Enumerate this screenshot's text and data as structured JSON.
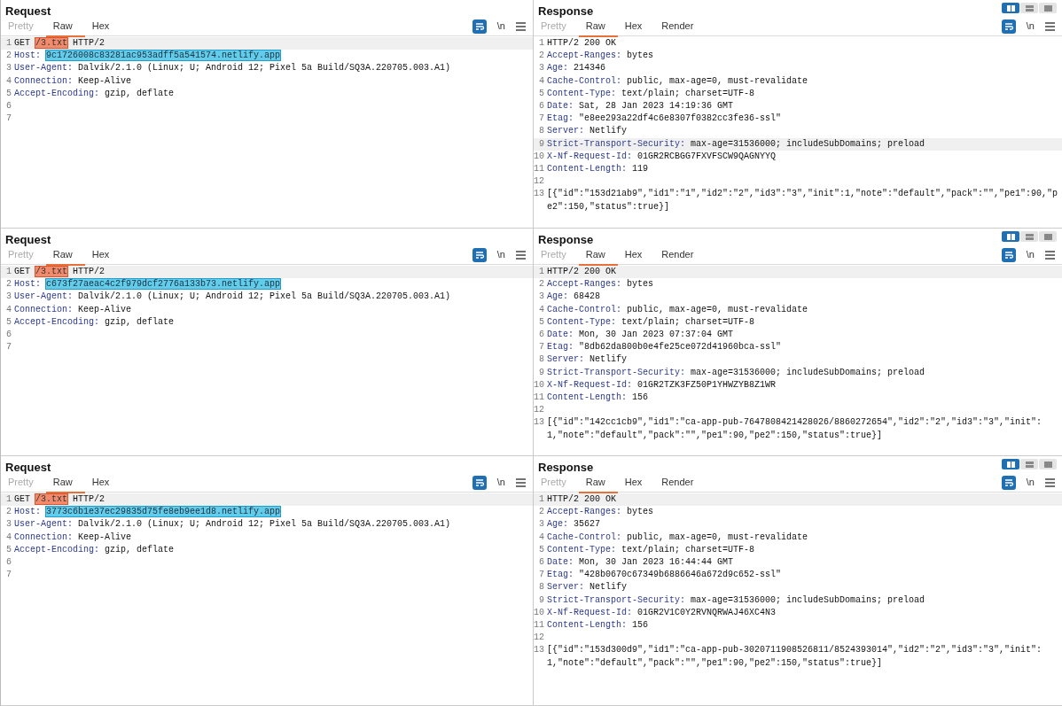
{
  "rows": [
    {
      "request": {
        "title": "Request",
        "tabs": [
          {
            "label": "Pretty",
            "selected": false,
            "disabled": true
          },
          {
            "label": "Raw",
            "selected": true,
            "disabled": false
          },
          {
            "label": "Hex",
            "selected": false,
            "disabled": false
          }
        ],
        "wrap_on": true,
        "newline_label": "\\n",
        "lines": [
          {
            "number": "1",
            "highlighted": true,
            "segments": [
              {
                "text": "GET ",
                "kind": "text"
              },
              {
                "text": "/3.txt",
                "kind": "path"
              },
              {
                "text": " HTTP/2",
                "kind": "text"
              }
            ]
          },
          {
            "number": "2",
            "highlighted": false,
            "segments": [
              {
                "text": "Host: ",
                "kind": "key"
              },
              {
                "text": "9c1726008c83281ac953adff5a541574.netlify.app",
                "kind": "host"
              }
            ]
          },
          {
            "number": "3",
            "highlighted": false,
            "segments": [
              {
                "text": "User-Agent:",
                "kind": "key"
              },
              {
                "text": " Dalvik/2.1.0 (Linux; U; Android 12; Pixel 5a Build/SQ3A.220705.003.A1)",
                "kind": "text"
              }
            ]
          },
          {
            "number": "4",
            "highlighted": false,
            "segments": [
              {
                "text": "Connection:",
                "kind": "key"
              },
              {
                "text": " Keep-Alive",
                "kind": "text"
              }
            ]
          },
          {
            "number": "5",
            "highlighted": false,
            "segments": [
              {
                "text": "Accept-Encoding:",
                "kind": "key"
              },
              {
                "text": " gzip, deflate",
                "kind": "text"
              }
            ]
          },
          {
            "number": "6",
            "highlighted": false
          },
          {
            "number": "7",
            "highlighted": false
          }
        ]
      },
      "response": {
        "title": "Response",
        "view_modes": [
          {
            "selected": true
          },
          {
            "selected": false
          },
          {
            "selected": false
          }
        ],
        "tabs": [
          {
            "label": "Pretty",
            "selected": false,
            "disabled": true
          },
          {
            "label": "Raw",
            "selected": true,
            "disabled": false
          },
          {
            "label": "Hex",
            "selected": false,
            "disabled": false
          },
          {
            "label": "Render",
            "selected": false,
            "disabled": false
          }
        ],
        "wrap_on": true,
        "newline_label": "\\n",
        "lines": [
          {
            "number": "1",
            "highlighted": false,
            "segments": [
              {
                "text": "HTTP/2 200 OK",
                "kind": "text"
              }
            ]
          },
          {
            "number": "2",
            "highlighted": false,
            "segments": [
              {
                "text": "Accept-Ranges:",
                "kind": "key"
              },
              {
                "text": " bytes",
                "kind": "text"
              }
            ]
          },
          {
            "number": "3",
            "highlighted": false,
            "segments": [
              {
                "text": "Age:",
                "kind": "key"
              },
              {
                "text": " 214346",
                "kind": "text"
              }
            ]
          },
          {
            "number": "4",
            "highlighted": false,
            "segments": [
              {
                "text": "Cache-Control:",
                "kind": "key"
              },
              {
                "text": " public, max-age=0, must-revalidate",
                "kind": "text"
              }
            ]
          },
          {
            "number": "5",
            "highlighted": false,
            "segments": [
              {
                "text": "Content-Type:",
                "kind": "key"
              },
              {
                "text": " text/plain; charset=UTF-8",
                "kind": "text"
              }
            ]
          },
          {
            "number": "6",
            "highlighted": false,
            "segments": [
              {
                "text": "Date:",
                "kind": "key"
              },
              {
                "text": " Sat, 28 Jan 2023 14:19:36 GMT",
                "kind": "text"
              }
            ]
          },
          {
            "number": "7",
            "highlighted": false,
            "segments": [
              {
                "text": "Etag:",
                "kind": "key"
              },
              {
                "text": " \"e8ee293a22df4c6e8307f0382cc3fe36-ssl\"",
                "kind": "text"
              }
            ]
          },
          {
            "number": "8",
            "highlighted": false,
            "segments": [
              {
                "text": "Server:",
                "kind": "key"
              },
              {
                "text": " Netlify",
                "kind": "text"
              }
            ]
          },
          {
            "number": "9",
            "highlighted": true,
            "segments": [
              {
                "text": "Strict-Transport-Security:",
                "kind": "key"
              },
              {
                "text": " max-age=31536000; includeSubDomains; preload",
                "kind": "text"
              }
            ]
          },
          {
            "number": "10",
            "highlighted": false,
            "segments": [
              {
                "text": "X-Nf-Request-Id:",
                "kind": "key"
              },
              {
                "text": " 01GR2RCBGG7FXVFSCW9QAGNYYQ",
                "kind": "text"
              }
            ]
          },
          {
            "number": "11",
            "highlighted": false,
            "segments": [
              {
                "text": "Content-Length:",
                "kind": "key"
              },
              {
                "text": " 119",
                "kind": "text"
              }
            ]
          },
          {
            "number": "12",
            "highlighted": false
          },
          {
            "number": "13",
            "highlighted": false,
            "segments": [
              {
                "text": "[{\"id\":\"153d21ab9\",\"id1\":\"1\",\"id2\":\"2\",\"id3\":\"3\",\"init\":1,\"note\":\"default\",\"pack\":\"\",\"pe1\":90,\"pe2\":150,\"status\":true}]",
                "kind": "text"
              }
            ]
          }
        ]
      }
    },
    {
      "request": {
        "title": "Request",
        "tabs": [
          {
            "label": "Pretty",
            "selected": false,
            "disabled": true
          },
          {
            "label": "Raw",
            "selected": true,
            "disabled": false
          },
          {
            "label": "Hex",
            "selected": false,
            "disabled": false
          }
        ],
        "wrap_on": true,
        "newline_label": "\\n",
        "lines": [
          {
            "number": "1",
            "highlighted": true,
            "segments": [
              {
                "text": "GET ",
                "kind": "text"
              },
              {
                "text": "/3.txt",
                "kind": "path"
              },
              {
                "text": " HTTP/2",
                "kind": "text"
              }
            ]
          },
          {
            "number": "2",
            "highlighted": false,
            "segments": [
              {
                "text": "Host: ",
                "kind": "key"
              },
              {
                "text": "c673f27aeac4c2f979dcf2776a133b73.netlify.app",
                "kind": "host"
              }
            ]
          },
          {
            "number": "3",
            "highlighted": false,
            "segments": [
              {
                "text": "User-Agent:",
                "kind": "key"
              },
              {
                "text": " Dalvik/2.1.0 (Linux; U; Android 12; Pixel 5a Build/SQ3A.220705.003.A1)",
                "kind": "text"
              }
            ]
          },
          {
            "number": "4",
            "highlighted": false,
            "segments": [
              {
                "text": "Connection:",
                "kind": "key"
              },
              {
                "text": " Keep-Alive",
                "kind": "text"
              }
            ]
          },
          {
            "number": "5",
            "highlighted": false,
            "segments": [
              {
                "text": "Accept-Encoding:",
                "kind": "key"
              },
              {
                "text": " gzip, deflate",
                "kind": "text"
              }
            ]
          },
          {
            "number": "6",
            "highlighted": false
          },
          {
            "number": "7",
            "highlighted": false
          }
        ]
      },
      "response": {
        "title": "Response",
        "view_modes": [
          {
            "selected": true
          },
          {
            "selected": false
          },
          {
            "selected": false
          }
        ],
        "tabs": [
          {
            "label": "Pretty",
            "selected": false,
            "disabled": true
          },
          {
            "label": "Raw",
            "selected": true,
            "disabled": false
          },
          {
            "label": "Hex",
            "selected": false,
            "disabled": false
          },
          {
            "label": "Render",
            "selected": false,
            "disabled": false
          }
        ],
        "wrap_on": true,
        "newline_label": "\\n",
        "lines": [
          {
            "number": "1",
            "highlighted": true,
            "segments": [
              {
                "text": "HTTP/2 200 OK",
                "kind": "text"
              }
            ]
          },
          {
            "number": "2",
            "highlighted": false,
            "segments": [
              {
                "text": "Accept-Ranges:",
                "kind": "key"
              },
              {
                "text": " bytes",
                "kind": "text"
              }
            ]
          },
          {
            "number": "3",
            "highlighted": false,
            "segments": [
              {
                "text": "Age:",
                "kind": "key"
              },
              {
                "text": " 68428",
                "kind": "text"
              }
            ]
          },
          {
            "number": "4",
            "highlighted": false,
            "segments": [
              {
                "text": "Cache-Control:",
                "kind": "key"
              },
              {
                "text": " public, max-age=0, must-revalidate",
                "kind": "text"
              }
            ]
          },
          {
            "number": "5",
            "highlighted": false,
            "segments": [
              {
                "text": "Content-Type:",
                "kind": "key"
              },
              {
                "text": " text/plain; charset=UTF-8",
                "kind": "text"
              }
            ]
          },
          {
            "number": "6",
            "highlighted": false,
            "segments": [
              {
                "text": "Date:",
                "kind": "key"
              },
              {
                "text": " Mon, 30 Jan 2023 07:37:04 GMT",
                "kind": "text"
              }
            ]
          },
          {
            "number": "7",
            "highlighted": false,
            "segments": [
              {
                "text": "Etag:",
                "kind": "key"
              },
              {
                "text": " \"8db62da800b0e4fe25ce072d41960bca-ssl\"",
                "kind": "text"
              }
            ]
          },
          {
            "number": "8",
            "highlighted": false,
            "segments": [
              {
                "text": "Server:",
                "kind": "key"
              },
              {
                "text": " Netlify",
                "kind": "text"
              }
            ]
          },
          {
            "number": "9",
            "highlighted": false,
            "segments": [
              {
                "text": "Strict-Transport-Security:",
                "kind": "key"
              },
              {
                "text": " max-age=31536000; includeSubDomains; preload",
                "kind": "text"
              }
            ]
          },
          {
            "number": "10",
            "highlighted": false,
            "segments": [
              {
                "text": "X-Nf-Request-Id:",
                "kind": "key"
              },
              {
                "text": " 01GR2TZK3FZ50P1YHWZYB8Z1WR",
                "kind": "text"
              }
            ]
          },
          {
            "number": "11",
            "highlighted": false,
            "segments": [
              {
                "text": "Content-Length:",
                "kind": "key"
              },
              {
                "text": " 156",
                "kind": "text"
              }
            ]
          },
          {
            "number": "12",
            "highlighted": false
          },
          {
            "number": "13",
            "highlighted": false,
            "segments": [
              {
                "text": "[{\"id\":\"142cc1cb9\",\"id1\":\"ca-app-pub-7647808421428026/8860272654\",\"id2\":\"2\",\"id3\":\"3\",\"init\":1,\"note\":\"default\",\"pack\":\"\",\"pe1\":90,\"pe2\":150,\"status\":true}]",
                "kind": "text"
              }
            ]
          }
        ]
      }
    },
    {
      "request": {
        "title": "Request",
        "tabs": [
          {
            "label": "Pretty",
            "selected": false,
            "disabled": true
          },
          {
            "label": "Raw",
            "selected": true,
            "disabled": false
          },
          {
            "label": "Hex",
            "selected": false,
            "disabled": false
          }
        ],
        "wrap_on": true,
        "newline_label": "\\n",
        "lines": [
          {
            "number": "1",
            "highlighted": true,
            "segments": [
              {
                "text": "GET ",
                "kind": "text"
              },
              {
                "text": "/3.txt",
                "kind": "path"
              },
              {
                "text": " HTTP/2",
                "kind": "text"
              }
            ]
          },
          {
            "number": "2",
            "highlighted": false,
            "segments": [
              {
                "text": "Host: ",
                "kind": "key"
              },
              {
                "text": "3773c6b1e37ec29835d75fe8eb9ee1d8.netlify.app",
                "kind": "host"
              }
            ]
          },
          {
            "number": "3",
            "highlighted": false,
            "segments": [
              {
                "text": "User-Agent:",
                "kind": "key"
              },
              {
                "text": " Dalvik/2.1.0 (Linux; U; Android 12; Pixel 5a Build/SQ3A.220705.003.A1)",
                "kind": "text"
              }
            ]
          },
          {
            "number": "4",
            "highlighted": false,
            "segments": [
              {
                "text": "Connection:",
                "kind": "key"
              },
              {
                "text": " Keep-Alive",
                "kind": "text"
              }
            ]
          },
          {
            "number": "5",
            "highlighted": false,
            "segments": [
              {
                "text": "Accept-Encoding:",
                "kind": "key"
              },
              {
                "text": " gzip, deflate",
                "kind": "text"
              }
            ]
          },
          {
            "number": "6",
            "highlighted": false
          },
          {
            "number": "7",
            "highlighted": false
          }
        ]
      },
      "response": {
        "title": "Response",
        "view_modes": [
          {
            "selected": true
          },
          {
            "selected": false
          },
          {
            "selected": false
          }
        ],
        "tabs": [
          {
            "label": "Pretty",
            "selected": false,
            "disabled": true
          },
          {
            "label": "Raw",
            "selected": true,
            "disabled": false
          },
          {
            "label": "Hex",
            "selected": false,
            "disabled": false
          },
          {
            "label": "Render",
            "selected": false,
            "disabled": false
          }
        ],
        "wrap_on": true,
        "newline_label": "\\n",
        "lines": [
          {
            "number": "1",
            "highlighted": true,
            "segments": [
              {
                "text": "HTTP/2 200 OK",
                "kind": "text"
              }
            ]
          },
          {
            "number": "2",
            "highlighted": false,
            "segments": [
              {
                "text": "Accept-Ranges:",
                "kind": "key"
              },
              {
                "text": " bytes",
                "kind": "text"
              }
            ]
          },
          {
            "number": "3",
            "highlighted": false,
            "segments": [
              {
                "text": "Age:",
                "kind": "key"
              },
              {
                "text": " 35627",
                "kind": "text"
              }
            ]
          },
          {
            "number": "4",
            "highlighted": false,
            "segments": [
              {
                "text": "Cache-Control:",
                "kind": "key"
              },
              {
                "text": " public, max-age=0, must-revalidate",
                "kind": "text"
              }
            ]
          },
          {
            "number": "5",
            "highlighted": false,
            "segments": [
              {
                "text": "Content-Type:",
                "kind": "key"
              },
              {
                "text": " text/plain; charset=UTF-8",
                "kind": "text"
              }
            ]
          },
          {
            "number": "6",
            "highlighted": false,
            "segments": [
              {
                "text": "Date:",
                "kind": "key"
              },
              {
                "text": " Mon, 30 Jan 2023 16:44:44 GMT",
                "kind": "text"
              }
            ]
          },
          {
            "number": "7",
            "highlighted": false,
            "segments": [
              {
                "text": "Etag:",
                "kind": "key"
              },
              {
                "text": " \"428b0670c67349b6886646a672d9c652-ssl\"",
                "kind": "text"
              }
            ]
          },
          {
            "number": "8",
            "highlighted": false,
            "segments": [
              {
                "text": "Server:",
                "kind": "key"
              },
              {
                "text": " Netlify",
                "kind": "text"
              }
            ]
          },
          {
            "number": "9",
            "highlighted": false,
            "segments": [
              {
                "text": "Strict-Transport-Security:",
                "kind": "key"
              },
              {
                "text": " max-age=31536000; includeSubDomains; preload",
                "kind": "text"
              }
            ]
          },
          {
            "number": "10",
            "highlighted": false,
            "segments": [
              {
                "text": "X-Nf-Request-Id:",
                "kind": "key"
              },
              {
                "text": " 01GR2V1C0Y2RVNQRWAJ46XC4N3",
                "kind": "text"
              }
            ]
          },
          {
            "number": "11",
            "highlighted": false,
            "segments": [
              {
                "text": "Content-Length:",
                "kind": "key"
              },
              {
                "text": " 156",
                "kind": "text"
              }
            ]
          },
          {
            "number": "12",
            "highlighted": false
          },
          {
            "number": "13",
            "highlighted": false,
            "segments": [
              {
                "text": "[{\"id\":\"153d300d9\",\"id1\":\"ca-app-pub-3020711908526811/8524393014\",\"id2\":\"2\",\"id3\":\"3\",\"init\":1,\"note\":\"default\",\"pack\":\"\",\"pe1\":90,\"pe2\":150,\"status\":true}]",
                "kind": "text"
              }
            ]
          }
        ]
      }
    }
  ]
}
